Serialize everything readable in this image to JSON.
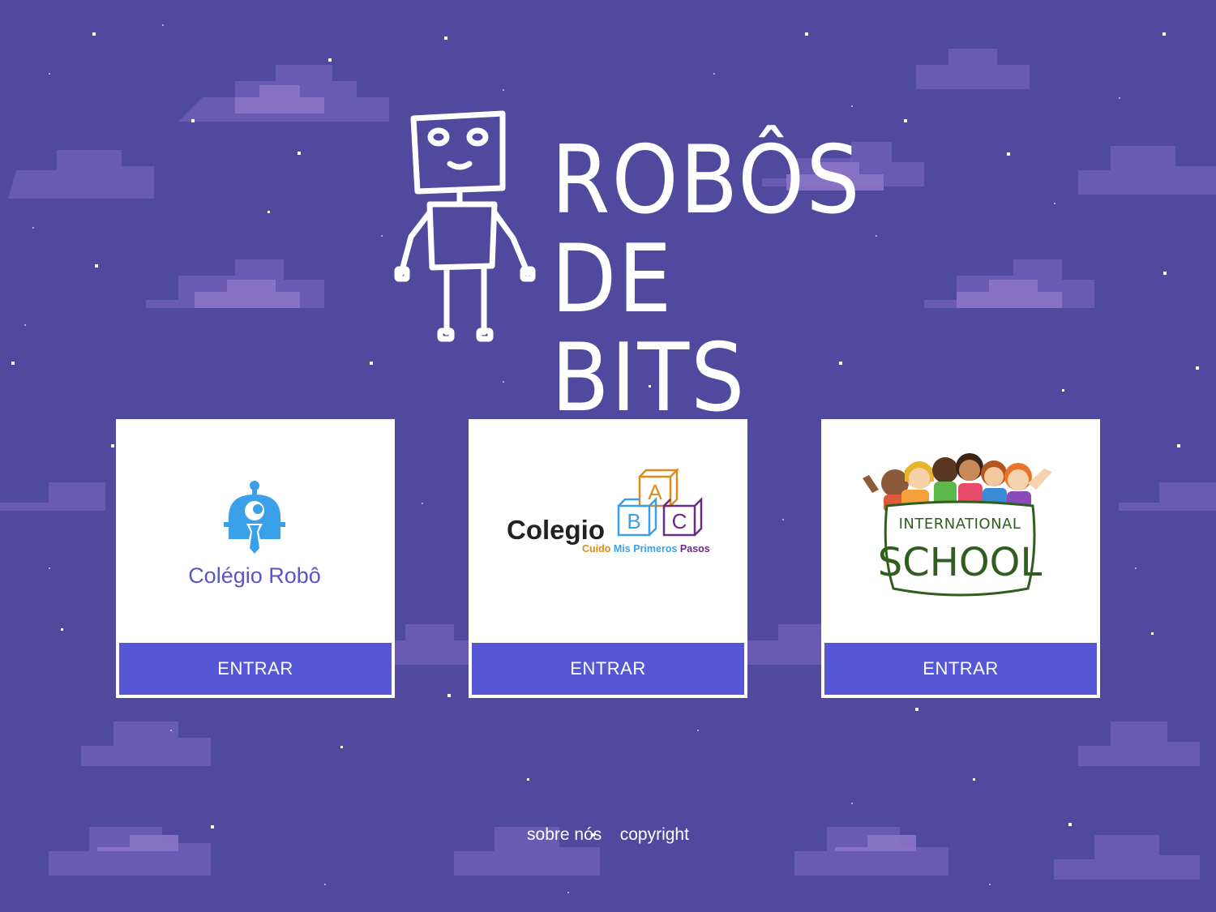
{
  "brand": {
    "title_line1": "ROBÔS",
    "title_line2": "DE BITS",
    "logo_icon": "robot-doodle-icon"
  },
  "schools": [
    {
      "name": "Colégio Robô",
      "logo_icon": "robot-head-icon",
      "button_label": "ENTRAR",
      "brand_color": "#3aa0ea"
    },
    {
      "name": "Colegio",
      "blocks": [
        "A",
        "B",
        "C"
      ],
      "tagline_words": [
        "Cuido",
        "Mis",
        "Primeros",
        "Pasos"
      ],
      "logo_icon": "abc-blocks-icon",
      "button_label": "ENTRAR"
    },
    {
      "name_line1": "INTERNATIONAL",
      "name_line2": "SCHOOL",
      "logo_icon": "children-group-icon",
      "button_label": "ENTRAR",
      "brand_color": "#2f5e1e"
    }
  ],
  "footer": {
    "about": "sobre nós",
    "copyright": "copyright"
  },
  "colors": {
    "background": "#504a9e",
    "button": "#5757d6",
    "cloud": "#8b74c8"
  }
}
